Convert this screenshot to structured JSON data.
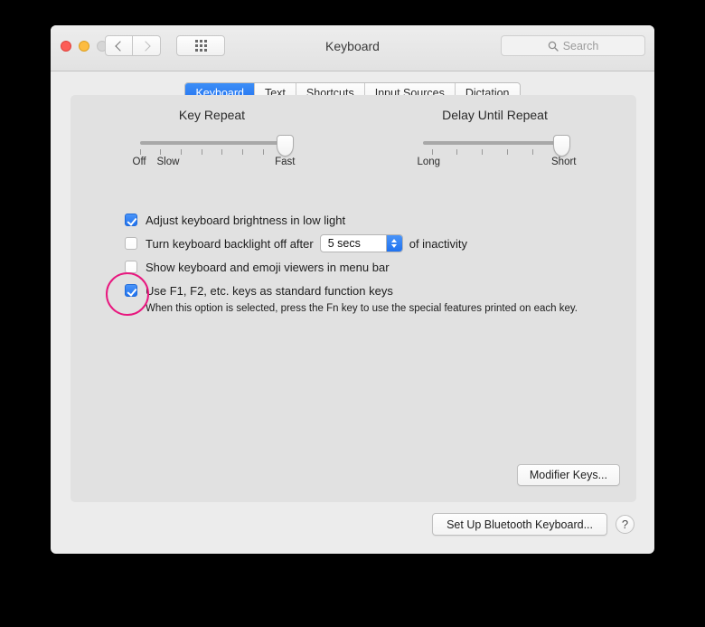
{
  "window": {
    "title": "Keyboard",
    "traffic_lights": [
      "close",
      "minimize",
      "zoom"
    ],
    "nav": {
      "back": "back-chevron",
      "forward": "forward-chevron",
      "show_all": "grid-icon"
    },
    "search": {
      "placeholder": "Search",
      "value": "",
      "icon": "search-icon"
    }
  },
  "tabs": [
    {
      "label": "Keyboard",
      "active": true
    },
    {
      "label": "Text",
      "active": false
    },
    {
      "label": "Shortcuts",
      "active": false
    },
    {
      "label": "Input Sources",
      "active": false
    },
    {
      "label": "Dictation",
      "active": false
    }
  ],
  "sliders": [
    {
      "title": "Key Repeat",
      "left_label": "Off",
      "second_label": "Slow",
      "right_label": "Fast",
      "ticks": 8,
      "value_percent": 100
    },
    {
      "title": "Delay Until Repeat",
      "left_label": "Long",
      "right_label": "Short",
      "ticks": 6,
      "value_percent": 96
    }
  ],
  "options": [
    {
      "label": "Adjust keyboard brightness in low light",
      "checked": true
    },
    {
      "label": "Turn keyboard backlight off after",
      "checked": false,
      "suffix": "of inactivity",
      "stepper_value": "5 secs"
    },
    {
      "label": "Show keyboard and emoji viewers in menu bar",
      "checked": false
    },
    {
      "label": "Use F1, F2, etc. keys as standard function keys",
      "checked": true,
      "annotated": true
    }
  ],
  "help_text": "When this option is selected, press the Fn key to use the special features printed on each key.",
  "buttons": {
    "modifier_keys": "Modifier Keys...",
    "bluetooth_keyboard": "Set Up Bluetooth Keyboard...",
    "help": "?"
  },
  "colors": {
    "accent_blue": "#1f72ef",
    "annotation_pink": "#e8187f",
    "window_bg": "#ececec",
    "panel_bg": "#e1e1e1"
  }
}
